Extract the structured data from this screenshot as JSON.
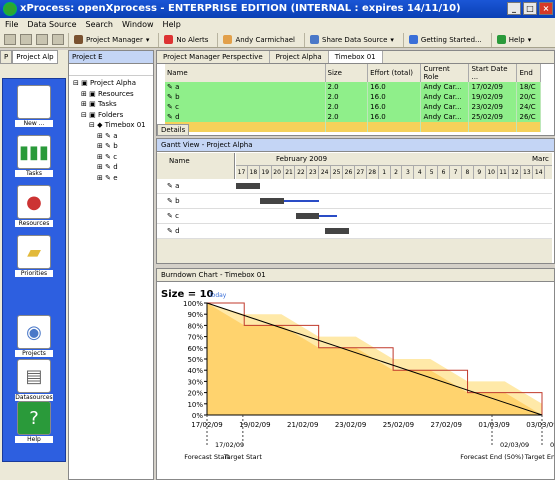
{
  "window": {
    "title": "xProcess: openXprocess - ENTERPRISE EDITION  (INTERNAL : expires 14/11/10)"
  },
  "menu": [
    "File",
    "Data Source",
    "Search",
    "Window",
    "Help"
  ],
  "toolbar": {
    "project_manager": "Project Manager",
    "alerts": "No Alerts",
    "user": "Andy Carmichael",
    "share": "Share Data Source",
    "getting_started": "Getting Started...",
    "help": "Help"
  },
  "left": {
    "tabs": [
      "P",
      "Project Alp"
    ],
    "items": [
      {
        "label": "New ...",
        "icon": "new-wand-icon"
      },
      {
        "label": "Tasks",
        "icon": "tasks-icon"
      },
      {
        "label": "Resources",
        "icon": "resources-icon"
      },
      {
        "label": "Priorities",
        "icon": "priorities-icon"
      },
      {
        "label": "Projects",
        "icon": "projects-icon"
      },
      {
        "label": "Datasources",
        "icon": "datasources-icon"
      },
      {
        "label": "Help",
        "icon": "help-icon"
      }
    ]
  },
  "explorer": {
    "tab": "Project E",
    "tree": [
      {
        "label": "Project Alpha",
        "level": 0
      },
      {
        "label": "Resources",
        "level": 1
      },
      {
        "label": "Tasks",
        "level": 1
      },
      {
        "label": "Folders",
        "level": 1
      },
      {
        "label": "Timebox 01",
        "level": 2
      },
      {
        "label": "a",
        "level": 3
      },
      {
        "label": "b",
        "level": 3
      },
      {
        "label": "c",
        "level": 3
      },
      {
        "label": "d",
        "level": 3
      },
      {
        "label": "e",
        "level": 3
      }
    ]
  },
  "editor_tabs": [
    "Project Manager Perspective",
    "Project Alpha",
    "Timebox 01"
  ],
  "tasks_table": {
    "columns": [
      "Name",
      "Size",
      "Effort (total)",
      "Current Role",
      "Start Date ...",
      "End"
    ],
    "rows": [
      {
        "name": "a",
        "size": "2.0",
        "effort": "16.0",
        "role": "Andy Car...",
        "start": "17/02/09",
        "end": "18/C",
        "color": "g"
      },
      {
        "name": "b",
        "size": "2.0",
        "effort": "16.0",
        "role": "Andy Car...",
        "start": "19/02/09",
        "end": "20/C",
        "color": "g"
      },
      {
        "name": "c",
        "size": "2.0",
        "effort": "16.0",
        "role": "Andy Car...",
        "start": "23/02/09",
        "end": "24/C",
        "color": "g"
      },
      {
        "name": "d",
        "size": "2.0",
        "effort": "16.0",
        "role": "Andy Car...",
        "start": "25/02/09",
        "end": "26/C",
        "color": "g"
      },
      {
        "name": "",
        "size": "",
        "effort": "",
        "role": "",
        "start": "",
        "end": "",
        "color": "y"
      }
    ],
    "details": "Details"
  },
  "gantt": {
    "title": "Gantt View - Project Alpha",
    "name_header": "Name",
    "month": "February 2009",
    "month2": "Marc",
    "days": [
      "17",
      "18",
      "19",
      "20",
      "21",
      "22",
      "23",
      "24",
      "25",
      "26",
      "27",
      "28",
      "1",
      "2",
      "3",
      "4",
      "5",
      "6",
      "7",
      "8",
      "9",
      "10",
      "11",
      "12",
      "13",
      "14"
    ],
    "rows": [
      {
        "name": "a",
        "start": 0,
        "dur": 2,
        "line": 0
      },
      {
        "name": "b",
        "start": 2,
        "dur": 2,
        "line": 3
      },
      {
        "name": "c",
        "start": 5,
        "dur": 2,
        "line": 1.5
      },
      {
        "name": "d",
        "start": 7.5,
        "dur": 2,
        "line": 0
      }
    ]
  },
  "burndown": {
    "title": "Burndown Chart - Timebox 01",
    "size_label": "Size = 10",
    "today_label": "Today",
    "annotations": [
      {
        "date": "17/02/09",
        "label": "Forecast Start"
      },
      {
        "date": "",
        "label": "Target Start"
      },
      {
        "date": "02/03/09",
        "label": "Forecast End (50%)"
      },
      {
        "date": "02/03/09",
        "label": "Target End"
      }
    ]
  },
  "chart_data": {
    "type": "area",
    "title": "Burndown Chart - Timebox 01",
    "x": [
      "17/02/09",
      "19/02/09",
      "21/02/09",
      "23/02/09",
      "25/02/09",
      "27/02/09",
      "01/03/09",
      "03/03/09"
    ],
    "ylabel": "",
    "yticks": [
      "100%",
      "90%",
      "80%",
      "70%",
      "60%",
      "50%",
      "40%",
      "30%",
      "20%",
      "10%",
      "0%"
    ],
    "ylim": [
      0,
      100
    ],
    "series": [
      {
        "values": [
          100,
          80,
          80,
          60,
          60,
          40,
          40,
          20,
          20,
          0
        ]
      }
    ],
    "colors": {
      "area": "#ffd36e",
      "upper": "#ffe9a8",
      "line": "#000000",
      "step": "#c0392b"
    }
  }
}
